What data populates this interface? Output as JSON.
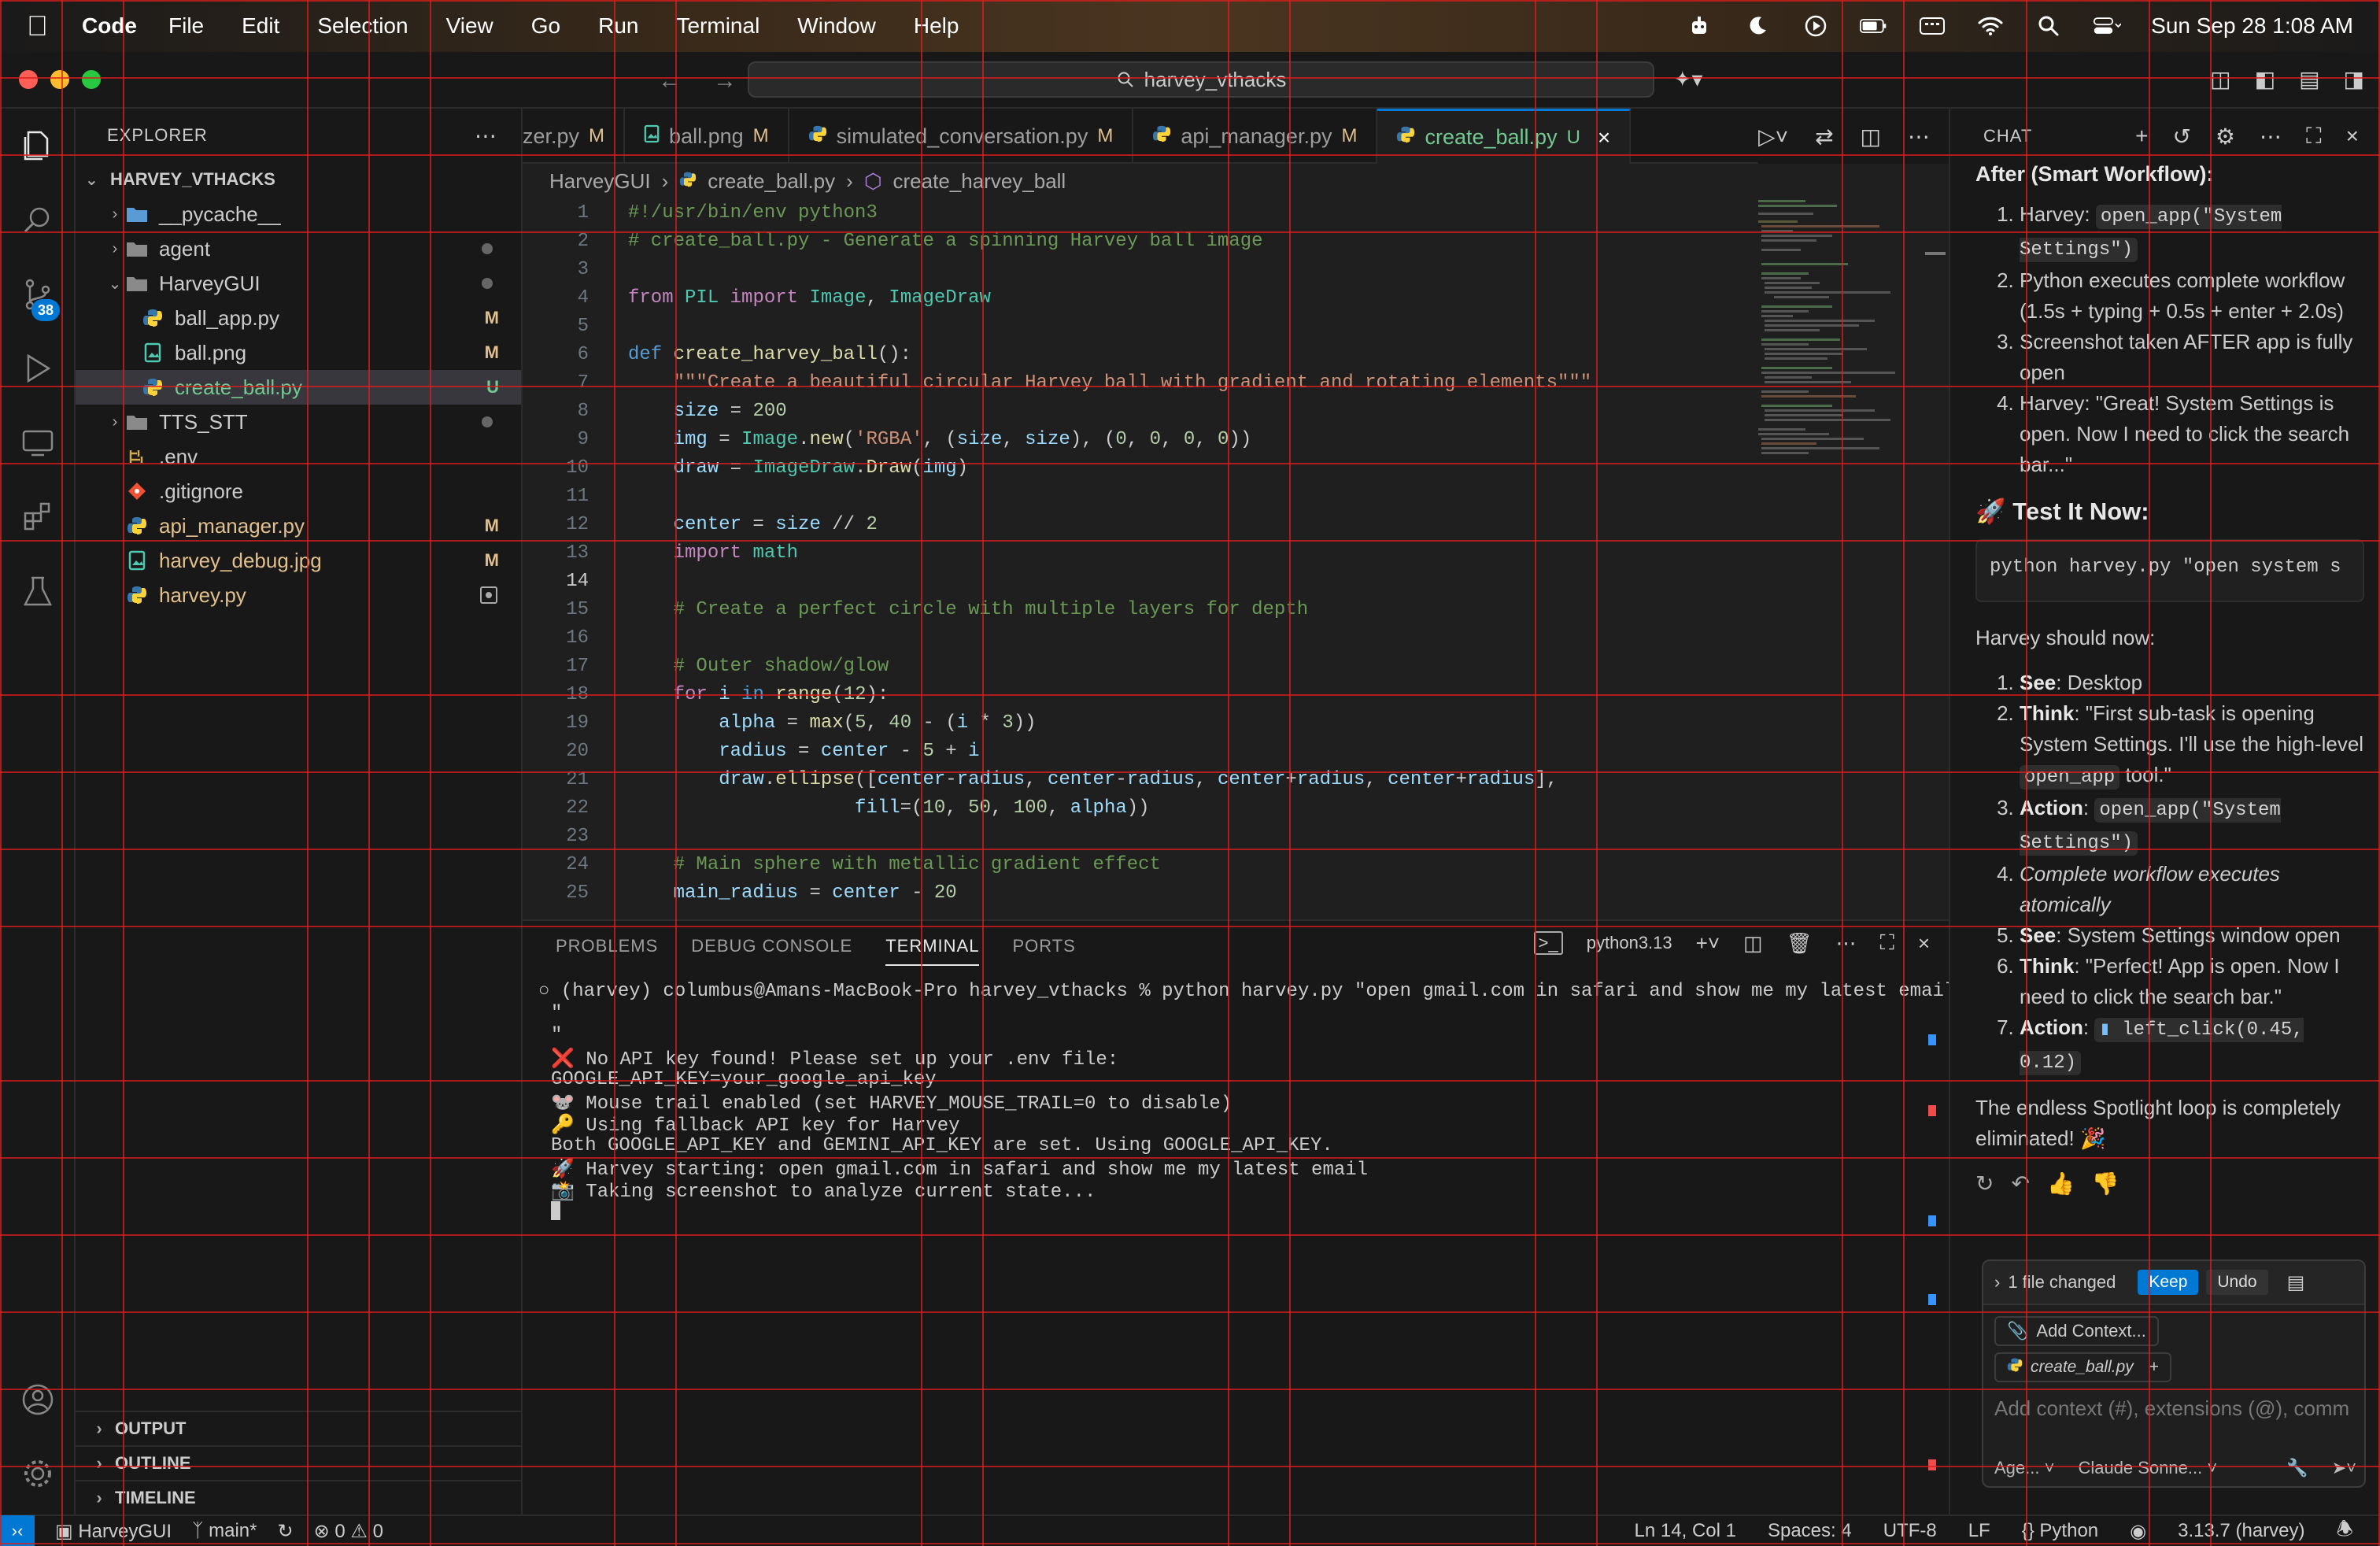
{
  "menubar": {
    "app": "Code",
    "items": [
      "File",
      "Edit",
      "Selection",
      "View",
      "Go",
      "Run",
      "Terminal",
      "Window",
      "Help"
    ],
    "datetime": "Sun Sep 28  1:08 AM"
  },
  "titlebar": {
    "search": "harvey_vthacks"
  },
  "activity": {
    "scm_badge": "38"
  },
  "explorer": {
    "header": "EXPLORER",
    "root": "HARVEY_VTHACKS",
    "items": [
      {
        "label": "__pycache__",
        "status": ""
      },
      {
        "label": "agent",
        "status": ""
      },
      {
        "label": "HarveyGUI",
        "status": ""
      },
      {
        "label": "ball_app.py",
        "status": "M"
      },
      {
        "label": "ball.png",
        "status": "M"
      },
      {
        "label": "create_ball.py",
        "status": "U"
      },
      {
        "label": "TTS_STT",
        "status": ""
      },
      {
        "label": ".env",
        "status": ""
      },
      {
        "label": ".gitignore",
        "status": ""
      },
      {
        "label": "api_manager.py",
        "status": "M"
      },
      {
        "label": "harvey_debug.jpg",
        "status": "M"
      },
      {
        "label": "harvey.py",
        "status": ""
      }
    ],
    "sections": [
      "OUTPUT",
      "OUTLINE",
      "TIMELINE"
    ]
  },
  "tabs": [
    {
      "label": "zer.py",
      "status": "M"
    },
    {
      "label": "ball.png",
      "status": "M"
    },
    {
      "label": "simulated_conversation.py",
      "status": "M"
    },
    {
      "label": "api_manager.py",
      "status": "M"
    },
    {
      "label": "create_ball.py",
      "status": "U"
    }
  ],
  "breadcrumb": [
    "HarveyGUI",
    "create_ball.py",
    "create_harvey_ball"
  ],
  "panel": {
    "tabs": [
      "PROBLEMS",
      "DEBUG CONSOLE",
      "TERMINAL",
      "PORTS"
    ],
    "shell": "python3.13",
    "terminal_lines": [
      "○ (harvey) columbus@Amans-MacBook-Pro harvey_vthacks % python harvey.py \"open gmail.com in safari and show me my latest email\"",
      "\"",
      "\"",
      "❌ No API key found! Please set up your .env file:",
      "GOOGLE_API_KEY=your_google_api_key",
      "🐭 Mouse trail enabled (set HARVEY_MOUSE_TRAIL=0 to disable)",
      "🔑 Using fallback API key for Harvey",
      "Both GOOGLE_API_KEY and GEMINI_API_KEY are set. Using GOOGLE_API_KEY.",
      "🚀 Harvey starting: open gmail.com in safari and show me my latest email",
      "📸 Taking screenshot to analyze current state..."
    ]
  },
  "chat": {
    "header": "CHAT",
    "after_heading": "After (Smart Workflow):",
    "after_items": [
      {
        "pre": "Harvey: ",
        "code": "open_app(\"System Settings\")",
        "post": ""
      },
      {
        "pre": "Python executes complete workflow (1.5s + typing + 0.5s + enter + 2.0s)",
        "code": "",
        "post": ""
      },
      {
        "pre": "Screenshot taken AFTER app is fully open",
        "code": "",
        "post": ""
      },
      {
        "pre": "Harvey: \"Great! System Settings is open. Now I need to click the search bar...\"",
        "code": "",
        "post": ""
      }
    ],
    "test_heading": "🚀 Test It Now:",
    "test_code": "python harvey.py \"open system s",
    "should_now": "Harvey should now:",
    "steps": [
      {
        "bold": "See",
        "text": ": Desktop"
      },
      {
        "bold": "Think",
        "text": ": \"First sub-task is opening System Settings. I'll use the high-level ",
        "code": "open_app",
        "text2": " tool.\""
      },
      {
        "bold": "Action",
        "text": ": ",
        "code": "open_app(\"System Settings\")"
      },
      {
        "italic": "Complete workflow executes atomically"
      },
      {
        "bold": "See",
        "text": ": System Settings window open"
      },
      {
        "bold": "Think",
        "text": ": \"Perfect! App is open. Now I need to click the search bar.\""
      },
      {
        "bold": "Action",
        "text": ": ",
        "code": "left_click(0.45, 0.12)"
      }
    ],
    "closing": "The endless Spotlight loop is completely eliminated! 🎉",
    "files_changed": "1 file changed",
    "keep": "Keep",
    "undo": "Undo",
    "add_context": "Add Context...",
    "context_file": "create_ball.py",
    "placeholder": "Add context (#), extensions (@), comm",
    "mode": "Age...",
    "model": "Claude Sonne..."
  },
  "statusbar": {
    "folder": "HarveyGUI",
    "branch": "main*",
    "errors": "0",
    "warnings": "0",
    "position": "Ln 14, Col 1",
    "spaces": "Spaces: 4",
    "encoding": "UTF-8",
    "eol": "LF",
    "language": "Python",
    "interpreter": "3.13.7 (harvey)"
  },
  "colors": {
    "accent": "#0078d4",
    "modified": "#e2c08d",
    "untracked": "#73c991"
  }
}
